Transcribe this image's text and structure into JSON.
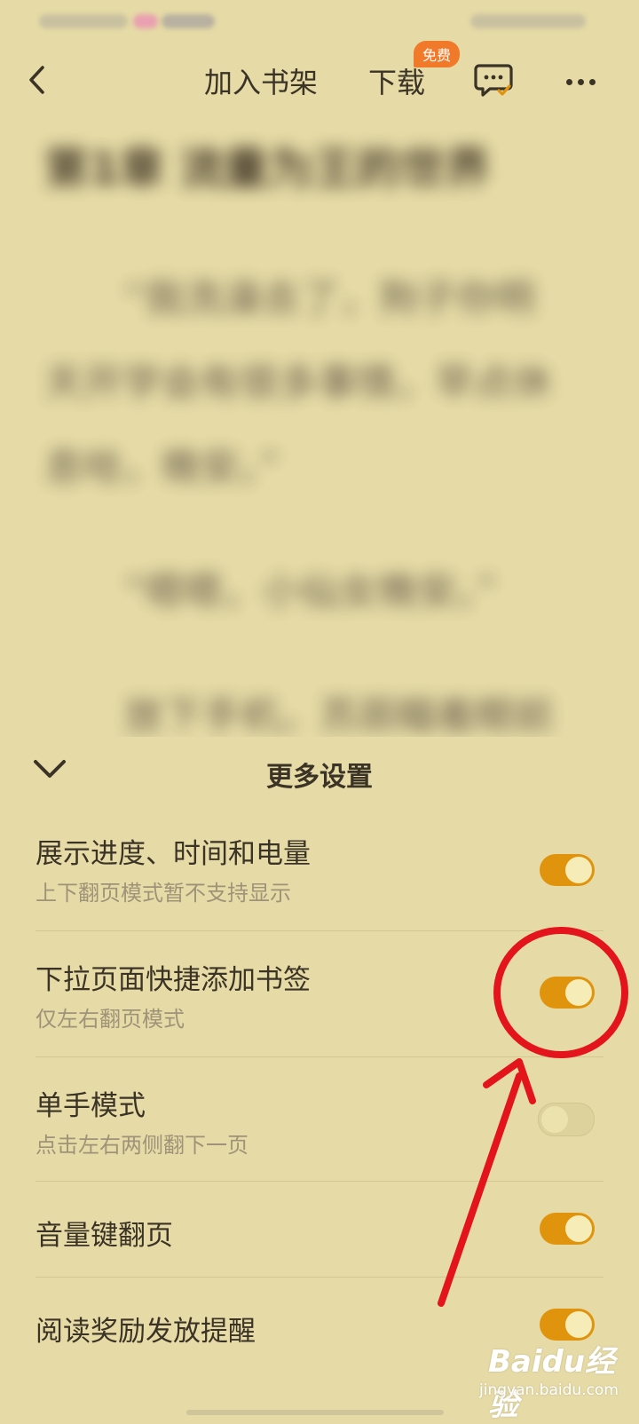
{
  "topbar": {
    "add_to_shelf": "加入书架",
    "download": "下载",
    "free_badge": "免费",
    "icons": {
      "back": "back-arrow-icon",
      "comment": "comment-icon",
      "more": "more-icon"
    }
  },
  "reader": {
    "chapter_title": "第1章 流量为王的世界",
    "paragraphs": [
      "“我洗澡去了，狗子你明",
      "天开学会有很多事情，早点休",
      "息哈，晚安。”",
      "“嗯嗯，小仙女晚安。”",
      "放下手机，苏辰瞄着眼前"
    ]
  },
  "panel": {
    "title": "更多设置",
    "settings": [
      {
        "label": "展示进度、时间和电量",
        "sub": "上下翻页模式暂不支持显示",
        "on": true
      },
      {
        "label": "下拉页面快捷添加书签",
        "sub": "仅左右翻页模式",
        "on": true
      },
      {
        "label": "单手模式",
        "sub": "点击左右两侧翻下一页",
        "on": false
      },
      {
        "label": "音量键翻页",
        "sub": "",
        "on": true
      },
      {
        "label": "阅读奖励发放提醒",
        "sub": "",
        "on": true
      }
    ]
  },
  "watermark": {
    "main": "Baidu经验",
    "sub": "jingyan.baidu.com"
  },
  "colors": {
    "toggle_on": "#e0930d",
    "background": "#e6dba6",
    "badge": "#f07a2a",
    "annotation": "#e3141b"
  }
}
